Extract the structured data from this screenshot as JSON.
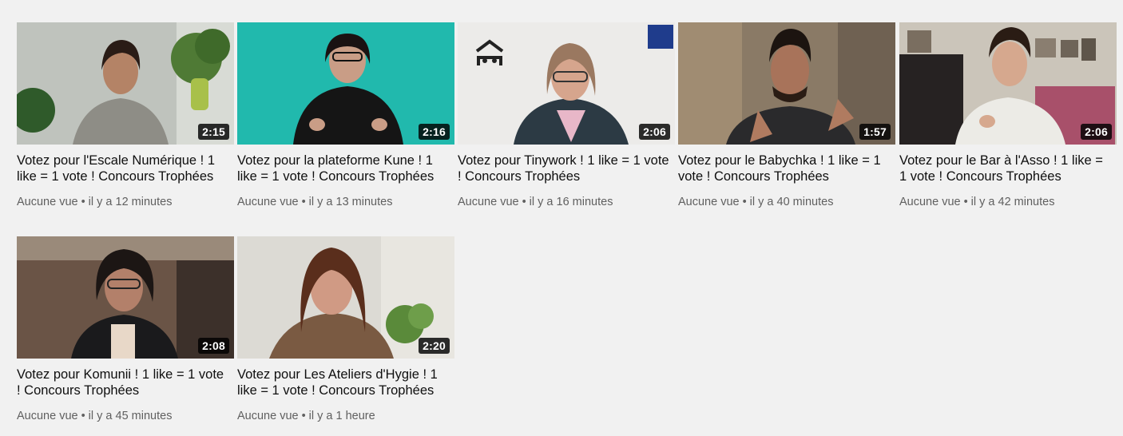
{
  "videos": [
    {
      "title": "Votez pour l'Escale Numérique ! 1 like = 1 vote ! Concours Trophées",
      "duration": "2:15",
      "views": "Aucune vue",
      "age": "il y a 12 minutes"
    },
    {
      "title": "Votez pour la plateforme Kune ! 1 like = 1 vote ! Concours Trophées",
      "duration": "2:16",
      "views": "Aucune vue",
      "age": "il y a 13 minutes"
    },
    {
      "title": "Votez pour Tinywork ! 1 like = 1 vote ! Concours Trophées",
      "duration": "2:06",
      "views": "Aucune vue",
      "age": "il y a 16 minutes"
    },
    {
      "title": "Votez pour le Babychka ! 1 like = 1 vote ! Concours Trophées",
      "duration": "1:57",
      "views": "Aucune vue",
      "age": "il y a 40 minutes"
    },
    {
      "title": "Votez pour le Bar à l'Asso ! 1 like = 1 vote ! Concours Trophées",
      "duration": "2:06",
      "views": "Aucune vue",
      "age": "il y a 42 minutes"
    },
    {
      "title": "Votez pour Komunii ! 1 like = 1 vote ! Concours Trophées",
      "duration": "2:08",
      "views": "Aucune vue",
      "age": "il y a 45 minutes"
    },
    {
      "title": "Votez pour Les Ateliers d'Hygie ! 1 like = 1 vote ! Concours Trophées",
      "duration": "2:20",
      "views": "Aucune vue",
      "age": "il y a 1 heure"
    }
  ],
  "separator": "•"
}
